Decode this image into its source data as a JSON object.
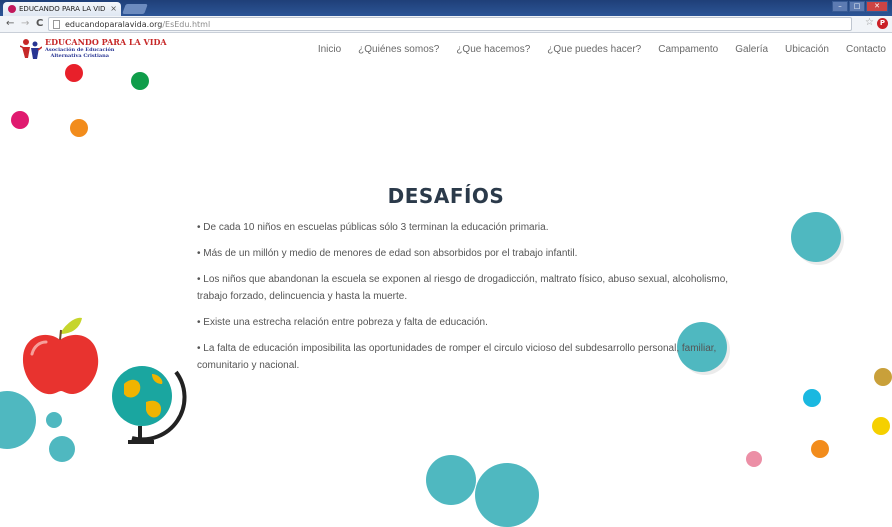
{
  "browser": {
    "tab_title": "EDUCANDO PARA LA VID",
    "tab_close": "×",
    "url_domain": "educandoparalavida.org",
    "url_path": "/EsEdu.html",
    "back": "←",
    "forward": "→",
    "reload": "C"
  },
  "site": {
    "brand": "EDUCANDO PARA LA VIDA",
    "brand_sub_line1": "Asociación de Educación",
    "brand_sub_line2": "Alternativa Cristiana",
    "nav": [
      "Inicio",
      "¿Quiénes somos?",
      "¿Que hacemos?",
      "¿Que puedes hacer?",
      "Campamento",
      "Galería",
      "Ubicación",
      "Contacto"
    ]
  },
  "content": {
    "title": "DESAFÍOS",
    "bullets": [
      "• De cada 10 niños en escuelas públicas sólo 3 terminan la educación primaria.",
      "• Más de un millón y medio de menores de edad son absorbidos por el trabajo infantil.",
      "• Los niños que abandonan la escuela se exponen al riesgo de drogadicción, maltrato físico, abuso sexual, alcoholismo, trabajo forzado, delincuencia y hasta la muerte.",
      "• Existe una estrecha relación entre pobreza y falta de educación.",
      "• La falta de educación imposibilita las oportunidades de romper el circulo vicioso del subdesarrollo personal, familiar, comunitario y nacional."
    ]
  },
  "colors": {
    "red": "#e8202a",
    "green": "#0f9d4a",
    "magenta": "#e01a6f",
    "orange": "#f28c1c",
    "teal": "#4fb8c0",
    "yellow": "#f5d000",
    "pink": "#ec8fa6",
    "cyan": "#1ab8e0",
    "ochre": "#c9a03a"
  }
}
